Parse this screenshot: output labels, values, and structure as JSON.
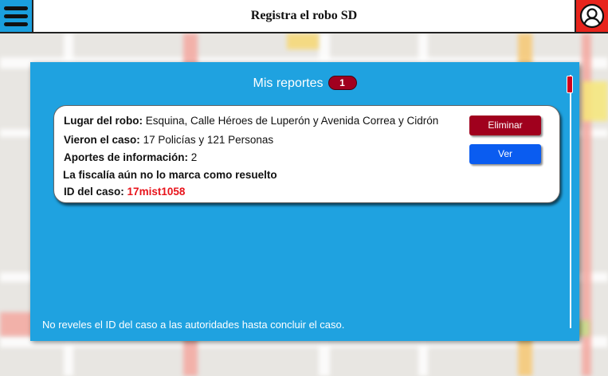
{
  "header": {
    "title": "Registra el robo SD"
  },
  "panel": {
    "title": "Mis reportes",
    "count": "1",
    "footer_note": "No reveles el ID del caso a las autoridades hasta concluir el caso."
  },
  "report": {
    "location_label": "Lugar del robo:",
    "location_value": "Esquina, Calle Héroes de Luperón y Avenida Correa y Cidrón",
    "seen_label": "Vieron el caso:",
    "seen_value": "17 Policías y 121 Personas",
    "contributions_label": "Aportes de información:",
    "contributions_value": "2",
    "status_text": "La fiscalía aún no lo marca como resuelto",
    "case_id_label": "ID del caso:",
    "case_id_value": "17mist1058",
    "delete_label": "Eliminar",
    "view_label": "Ver"
  },
  "colors": {
    "accent_blue": "#1fa2e0",
    "delete_red": "#a0001d",
    "view_blue": "#0a5cf0",
    "profile_red": "#e8241c",
    "case_id_red": "#e8131b"
  },
  "icons": {
    "menu": "hamburger-menu-icon",
    "profile": "user-profile-icon"
  }
}
